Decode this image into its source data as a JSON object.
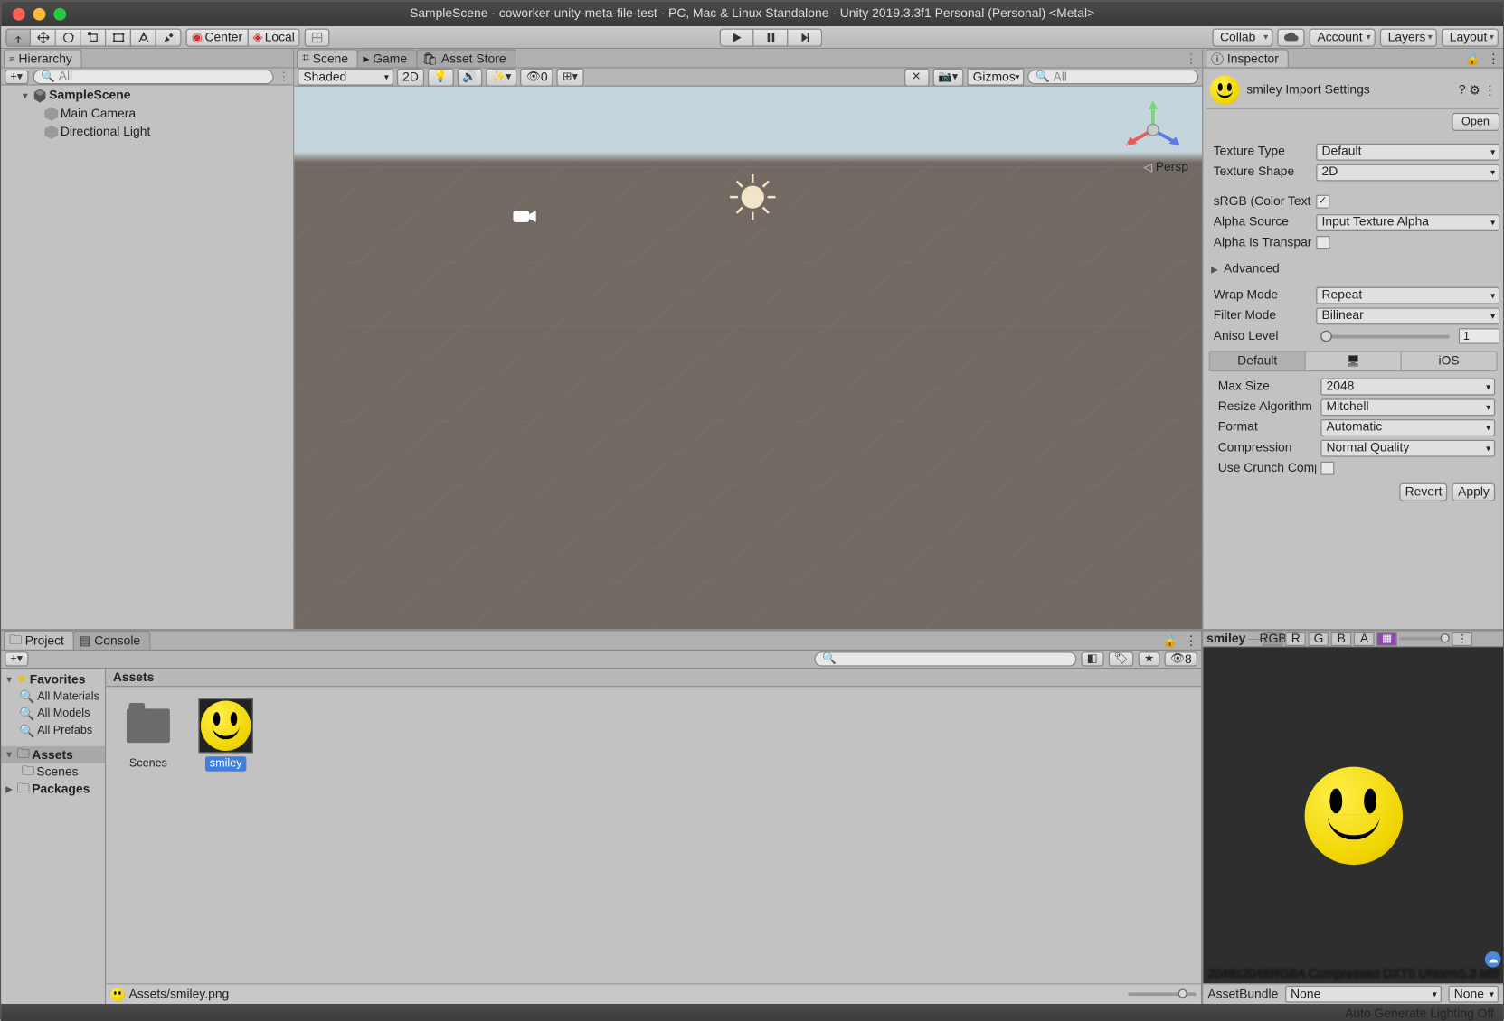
{
  "window": {
    "title": "SampleScene - coworker-unity-meta-file-test - PC, Mac & Linux Standalone - Unity 2019.3.3f1 Personal (Personal) <Metal>"
  },
  "toolbar": {
    "pivot": "Center",
    "space": "Local",
    "collab": "Collab",
    "account": "Account",
    "layers": "Layers",
    "layout": "Layout"
  },
  "hierarchy": {
    "title": "Hierarchy",
    "search_placeholder": "All",
    "scene": "SampleScene",
    "items": [
      "Main Camera",
      "Directional Light"
    ]
  },
  "scene": {
    "tab_scene": "Scene",
    "tab_game": "Game",
    "tab_asset_store": "Asset Store",
    "shading": "Shaded",
    "twod": "2D",
    "gizmos": "Gizmos",
    "search_placeholder": "All",
    "hidden_count": "0",
    "persp": "Persp"
  },
  "inspector": {
    "title": "Inspector",
    "asset_title": "smiley Import Settings",
    "open": "Open",
    "texture_type_label": "Texture Type",
    "texture_type": "Default",
    "texture_shape_label": "Texture Shape",
    "texture_shape": "2D",
    "srgb_label": "sRGB (Color Texture)",
    "alpha_source_label": "Alpha Source",
    "alpha_source": "Input Texture Alpha",
    "alpha_trans_label": "Alpha Is Transparenc",
    "advanced": "Advanced",
    "wrap_label": "Wrap Mode",
    "wrap": "Repeat",
    "filter_label": "Filter Mode",
    "filter": "Bilinear",
    "aniso_label": "Aniso Level",
    "aniso": "1",
    "plat_default": "Default",
    "plat_ios": "iOS",
    "maxsize_label": "Max Size",
    "maxsize": "2048",
    "resize_label": "Resize Algorithm",
    "resize": "Mitchell",
    "format_label": "Format",
    "format": "Automatic",
    "compression_label": "Compression",
    "compression": "Normal Quality",
    "crunch_label": "Use Crunch Compres",
    "revert": "Revert",
    "apply": "Apply"
  },
  "project": {
    "tab_project": "Project",
    "tab_console": "Console",
    "hidden": "8",
    "favorites": "Favorites",
    "fav_items": [
      "All Materials",
      "All Models",
      "All Prefabs"
    ],
    "assets": "Assets",
    "scenes": "Scenes",
    "packages": "Packages",
    "breadcrumb": "Assets",
    "items": [
      {
        "label": "Scenes"
      },
      {
        "label": "smiley",
        "selected": true
      }
    ],
    "path": "Assets/smiley.png"
  },
  "preview": {
    "name": "smiley",
    "rgb": "RGB",
    "r": "R",
    "g": "G",
    "b": "B",
    "a": "A",
    "dims": "2048x2048",
    "fmt": "RGBA Compressed DXT5 UNorm",
    "size": "5.3 MB",
    "assetbundle": "AssetBundle",
    "none": "None"
  },
  "status": {
    "text": "Auto Generate Lighting Off"
  }
}
